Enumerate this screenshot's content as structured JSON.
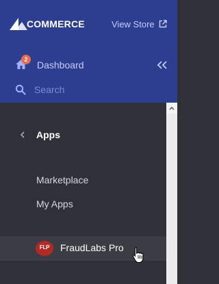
{
  "brand": {
    "logo_text": "COMMERCE"
  },
  "header": {
    "view_store_label": "View Store",
    "dashboard_label": "Dashboard",
    "notification_count": "2",
    "search_placeholder": "Search"
  },
  "submenu": {
    "title": "Apps",
    "items": [
      {
        "label": "Marketplace"
      },
      {
        "label": "My Apps"
      }
    ],
    "apps": [
      {
        "label": "FraudLabs Pro",
        "icon_text": "FLP"
      }
    ]
  },
  "colors": {
    "header_bg": "#2d3d8f",
    "menu_bg": "#303038",
    "link": "#c6ceff",
    "badge": "#e8694b",
    "app_icon": "#b22a23"
  }
}
